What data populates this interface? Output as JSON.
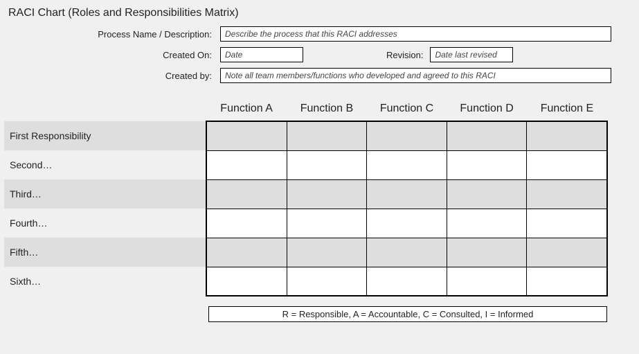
{
  "title": "RACI Chart (Roles and Responsibilities Matrix)",
  "meta": {
    "process_label": "Process Name / Description:",
    "process_placeholder": "Describe the process that this RACI addresses",
    "created_on_label": "Created On:",
    "created_on_placeholder": "Date",
    "revision_label": "Revision:",
    "revision_placeholder": "Date last revised",
    "created_by_label": "Created by:",
    "created_by_placeholder": "Note all team members/functions who developed and agreed to this RACI"
  },
  "chart_data": {
    "type": "table",
    "columns": [
      "Function A",
      "Function B",
      "Function C",
      "Function D",
      "Function E"
    ],
    "rows": [
      {
        "label": "First Responsibility",
        "values": [
          "",
          "",
          "",
          "",
          ""
        ]
      },
      {
        "label": "Second…",
        "values": [
          "",
          "",
          "",
          "",
          ""
        ]
      },
      {
        "label": "Third…",
        "values": [
          "",
          "",
          "",
          "",
          ""
        ]
      },
      {
        "label": "Fourth…",
        "values": [
          "",
          "",
          "",
          "",
          ""
        ]
      },
      {
        "label": "Fifth…",
        "values": [
          "",
          "",
          "",
          "",
          ""
        ]
      },
      {
        "label": "Sixth…",
        "values": [
          "",
          "",
          "",
          "",
          ""
        ]
      }
    ],
    "legend": "R = Responsible, A = Accountable, C = Consulted, I = Informed"
  }
}
